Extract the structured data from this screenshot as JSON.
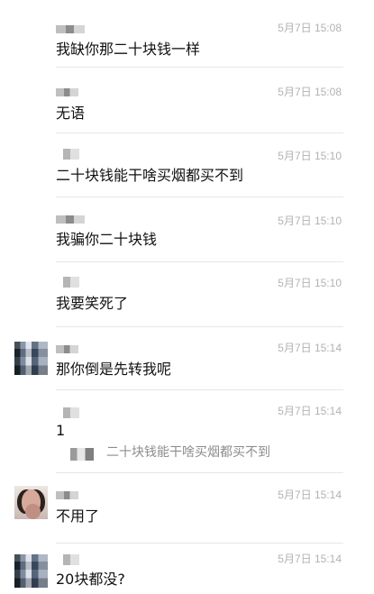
{
  "messages": [
    {
      "timestamp": "5月7日 15:08",
      "text": "我缺你那二十块钱一样"
    },
    {
      "timestamp": "5月7日 15:08",
      "text": "无语"
    },
    {
      "timestamp": "5月7日 15:10",
      "text": "二十块钱能干啥买烟都买不到"
    },
    {
      "timestamp": "5月7日 15:10",
      "text": "我骗你二十块钱"
    },
    {
      "timestamp": "5月7日 15:10",
      "text": "我要笑死了"
    },
    {
      "timestamp": "5月7日 15:14",
      "text": "那你倒是先转我呢"
    },
    {
      "timestamp": "5月7日 15:14",
      "text": "1",
      "quote": "二十块钱能干啥买烟都买不到"
    },
    {
      "timestamp": "5月7日 15:14",
      "text": "不用了"
    },
    {
      "timestamp": "5月7日 15:14",
      "text": "20块都没?"
    }
  ]
}
